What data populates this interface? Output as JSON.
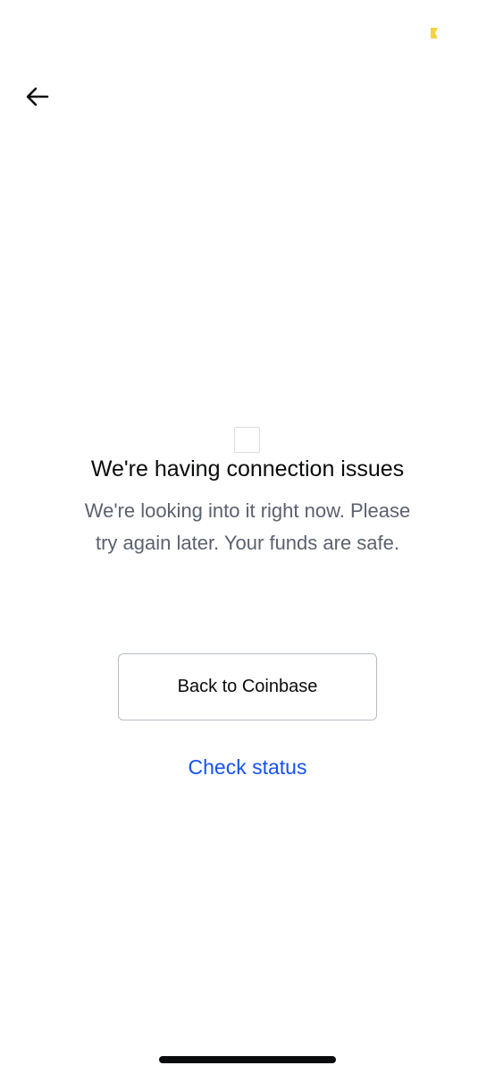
{
  "status_bar": {
    "indicator_icon": "battery-icon",
    "indicator_color": "#F5D33D"
  },
  "header": {
    "back_icon": "arrow-left-icon"
  },
  "error": {
    "image_icon": "image-placeholder-icon",
    "title": "We're having connection issues",
    "message": "We're looking into it right now. Please try again later. Your funds are safe."
  },
  "actions": {
    "back_label": "Back to Coinbase",
    "status_label": "Check status"
  },
  "colors": {
    "link": "#1652F0",
    "secondary_text": "#5B616E",
    "primary_text": "#0A0B0D"
  }
}
